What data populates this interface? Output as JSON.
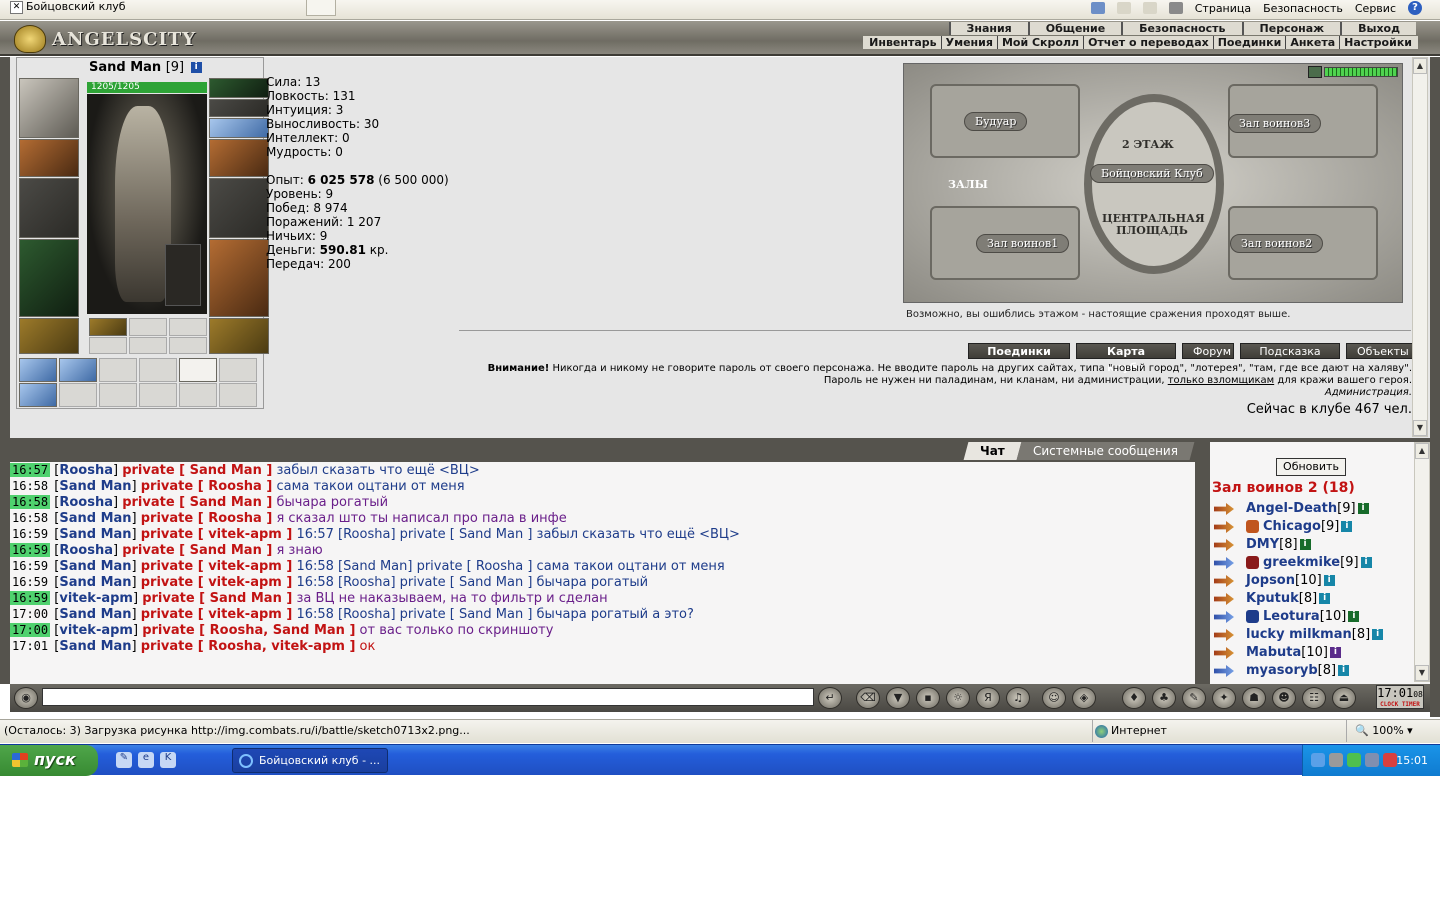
{
  "browser": {
    "tab_title": "Бойцовский клуб",
    "cmd_page": "Страница",
    "cmd_security": "Безопасность",
    "cmd_service": "Сервис"
  },
  "game": {
    "logo_text": "ANGELSCITY",
    "nav_top": [
      "Знания",
      "Общение",
      "Безопасность",
      "Персонаж",
      "Выход"
    ],
    "nav_bottom": [
      "Инвентарь",
      "Умения",
      "Мой Скролл",
      "Отчет о переводах",
      "Поединки",
      "Анкета",
      "Настройки"
    ]
  },
  "character": {
    "name": "Sand Man",
    "level": "[9]",
    "hp": "1205/1205",
    "stats": [
      {
        "label": "Сила:",
        "value": "13"
      },
      {
        "label": "Ловкость:",
        "value": "131"
      },
      {
        "label": "Интуиция:",
        "value": "3"
      },
      {
        "label": "Выносливость:",
        "value": "30"
      },
      {
        "label": "Интеллект:",
        "value": "0"
      },
      {
        "label": "Мудрость:",
        "value": "0"
      }
    ],
    "exp_label": "Опыт:",
    "exp_value": "6 025 578",
    "exp_next": "(6 500 000)",
    "level_label": "Уровень:",
    "level_value": "9",
    "wins_label": "Побед:",
    "wins_value": "8 974",
    "losses_label": "Поражений:",
    "losses_value": "1 207",
    "draws_label": "Ничьих:",
    "draws_value": "9",
    "money_label": "Деньги:",
    "money_value": "590.81",
    "money_unit": "кр.",
    "transfers_label": "Передач:",
    "transfers_value": "200"
  },
  "map": {
    "floor": "2 ЭТАЖ",
    "center": "Бойцовский Клуб",
    "square_1": "ЦЕНТРАЛЬНАЯ",
    "square_2": "ПЛОЩАДЬ",
    "halls": "ЗАЛЫ",
    "boudoir": "Будуар",
    "hall1": "Зал воинов1",
    "hall2": "Зал воинов2",
    "hall3": "Зал воинов3",
    "hint": "Возможно, вы ошиблись этажом - настоящие сражения проходят выше."
  },
  "buttons": [
    "Поединки",
    "Карта клуба",
    "Форум",
    "Подсказка",
    "Объекты"
  ],
  "warning": {
    "bold": "Внимание!",
    "text": " Никогда и никому не говорите пароль от своего персонажа. Не вводите пароль на других сайтах, типа \"новый город\", \"лотерея\", \"там, где все дают на халяву\". Пароль не нужен ни паладинам, ни кланам, ни администрации, ",
    "underline": "только взломщикам",
    "tail": " для кражи вашего героя.",
    "admin": "Администрация."
  },
  "online": "Сейчас в клубе 467 чел.",
  "chat": {
    "tab_chat": "Чат",
    "tab_system": "Системные сообщения",
    "lines": [
      {
        "time": "16:57",
        "hl": true,
        "from": "Roosha",
        "to": "private [ Sand Man ]",
        "msg": "забыл сказать что ещё <ВЦ>",
        "style": ""
      },
      {
        "time": "16:58",
        "hl": false,
        "from": "Sand Man",
        "to": "private [ Roosha ]",
        "msg": "сама такои оцтани от меня",
        "style": ""
      },
      {
        "time": "16:58",
        "hl": true,
        "from": "Roosha",
        "to": "private [ Sand Man ]",
        "msg": "бычара рогатый",
        "style": "purple"
      },
      {
        "time": "16:58",
        "hl": false,
        "from": "Sand Man",
        "to": "private [ Roosha ]",
        "msg": "я сказал што ты написал про пала в инфе",
        "style": "purple"
      },
      {
        "time": "16:59",
        "hl": false,
        "from": "Sand Man",
        "to": "private [ vitek-apm ]",
        "msg": "16:57 [Roosha] private [ Sand Man ] забыл сказать что ещё <ВЦ>",
        "style": ""
      },
      {
        "time": "16:59",
        "hl": true,
        "from": "Roosha",
        "to": "private [ Sand Man ]",
        "msg": "я знаю",
        "style": "purple"
      },
      {
        "time": "16:59",
        "hl": false,
        "from": "Sand Man",
        "to": "private [ vitek-apm ]",
        "msg": "16:58 [Sand Man] private [ Roosha ] сама такои оцтани от меня",
        "style": ""
      },
      {
        "time": "16:59",
        "hl": false,
        "from": "Sand Man",
        "to": "private [ vitek-apm ]",
        "msg": "16:58 [Roosha] private [ Sand Man ] бычара рогатый",
        "style": ""
      },
      {
        "time": "16:59",
        "hl": true,
        "from": "vitek-apm",
        "to": "private [ Sand Man ]",
        "msg": "за ВЦ не наказываем, на то фильтр и сделан",
        "style": "purple"
      },
      {
        "time": "17:00",
        "hl": false,
        "from": "Sand Man",
        "to": "private [ vitek-apm ]",
        "msg": "16:58 [Roosha] private [ Sand Man ] бычара рогатый а это?",
        "style": ""
      },
      {
        "time": "17:00",
        "hl": true,
        "from": "vitek-apm",
        "to": "private [ Roosha, Sand Man ]",
        "msg": "от вас только по скриншоту",
        "style": "purple"
      },
      {
        "time": "17:01",
        "hl": false,
        "from": "Sand Man",
        "to": "private [ Roosha, vitek-apm ]",
        "msg": "ок",
        "style": "red"
      }
    ]
  },
  "users": {
    "refresh": "Обновить",
    "room": "Зал воинов 2 (18)",
    "list": [
      {
        "name": "Angel-Death",
        "level": "[9]",
        "clan": "",
        "arrow": "orange",
        "info": "green"
      },
      {
        "name": "Chicago",
        "level": "[9]",
        "clan": "#c0551e",
        "arrow": "orange",
        "info": "cyan"
      },
      {
        "name": "DMY",
        "level": "[8]",
        "clan": "",
        "arrow": "orange",
        "info": "green"
      },
      {
        "name": "greekmike",
        "level": "[9]",
        "clan": "#8a1a1a",
        "arrow": "blue",
        "info": "cyan"
      },
      {
        "name": "Jopson",
        "level": "[10]",
        "clan": "",
        "arrow": "orange",
        "info": "cyan"
      },
      {
        "name": "Kputuk",
        "level": "[8]",
        "clan": "",
        "arrow": "orange",
        "info": "cyan"
      },
      {
        "name": "Leotura",
        "level": "[10]",
        "clan": "#1e3c8a",
        "arrow": "blue",
        "info": "green"
      },
      {
        "name": "lucky milkman",
        "level": "[8]",
        "clan": "",
        "arrow": "orange",
        "info": "cyan"
      },
      {
        "name": "Mabuta",
        "level": "[10]",
        "clan": "",
        "arrow": "orange",
        "info": "purple"
      },
      {
        "name": "myasoryb",
        "level": "[8]",
        "clan": "",
        "arrow": "blue",
        "info": "cyan"
      }
    ]
  },
  "toolbar": {
    "clock_time": "17:01",
    "clock_sec": "08",
    "clock_label": "CLOCK",
    "timer_label": "TIMER"
  },
  "statusbar": {
    "text": "(Осталось: 3) Загрузка рисунка http://img.combats.ru/i/battle/sketch0713x2.png...",
    "zone": "Интернет",
    "zoom": "100%"
  },
  "taskbar": {
    "start": "пуск",
    "task": "Бойцовский клуб - ...",
    "clock": "15:01"
  }
}
